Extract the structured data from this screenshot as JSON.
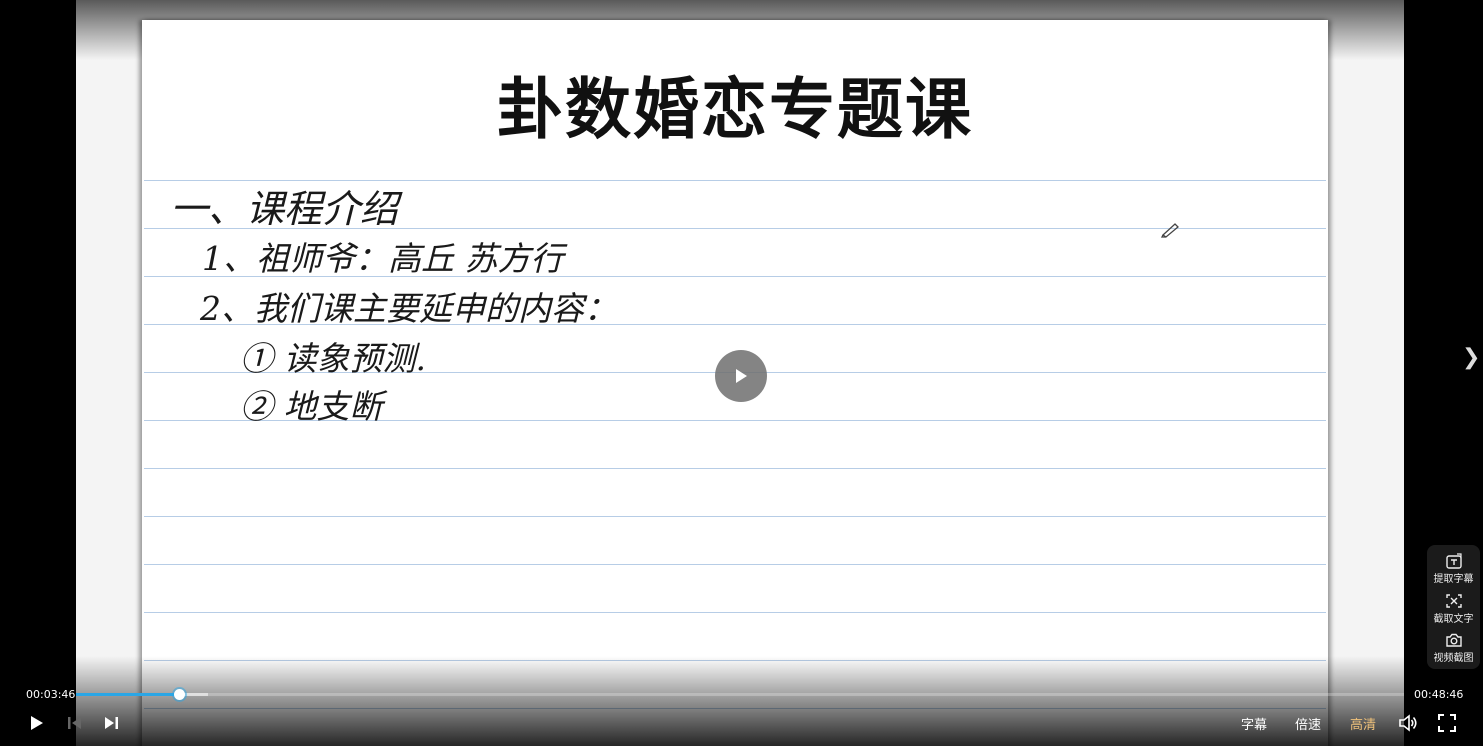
{
  "slide": {
    "title": "卦数婚恋专题课",
    "lines": [
      "一、课程介绍",
      "1、祖师爷：高丘 苏方行",
      "2、我们课主要延申的内容：",
      "① 读象预测.",
      "② 地支断"
    ]
  },
  "player": {
    "current_time": "00:03:46",
    "total_time": "00:48:46",
    "progress_fraction": 0.0773,
    "buffered_fraction": 0.0995,
    "controls": {
      "subtitle_label": "字幕",
      "speed_label": "倍速",
      "quality_label": "高清"
    },
    "accent_color": "#2aa6e6",
    "quality_color": "#f0c27b"
  },
  "side_tools": {
    "extract_subtitles": "提取字幕",
    "capture_text": "截取文字",
    "video_screenshot": "视频截图"
  },
  "icons": {
    "big_play": "play-icon",
    "play": "play-icon",
    "prev": "previous-icon",
    "next": "next-icon",
    "volume": "volume-icon",
    "fullscreen": "fullscreen-icon",
    "side_arrow": "chevron-right-icon",
    "extract": "extract-subtitle-icon",
    "capture": "capture-text-icon",
    "camera": "camera-icon",
    "pencil": "pencil-icon"
  }
}
